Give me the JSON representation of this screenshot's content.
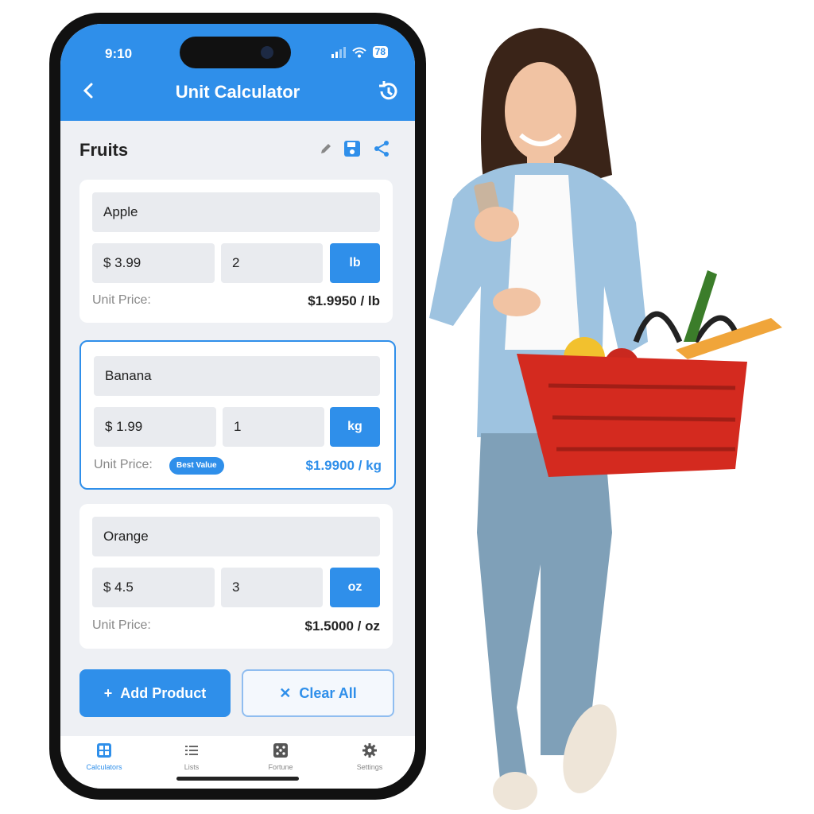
{
  "status_bar": {
    "time": "9:10",
    "battery": "78"
  },
  "header": {
    "title": "Unit Calculator"
  },
  "list": {
    "name": "Fruits"
  },
  "products": [
    {
      "name": "Apple",
      "price": "$ 3.99",
      "quantity": "2",
      "unit": "lb",
      "unit_price_label": "Unit Price:",
      "unit_price": "$1.9950 / lb"
    },
    {
      "name": "Banana",
      "price": "$ 1.99",
      "quantity": "1",
      "unit": "kg",
      "unit_price_label": "Unit Price:",
      "badge": "Best Value",
      "unit_price": "$1.9900 / kg"
    },
    {
      "name": "Orange",
      "price": "$ 4.5",
      "quantity": "3",
      "unit": "oz",
      "unit_price_label": "Unit Price:",
      "unit_price": "$1.5000 / oz"
    }
  ],
  "actions": {
    "add": "Add Product",
    "clear": "Clear All"
  },
  "tabs": [
    {
      "label": "Calculators",
      "icon": "calculator-icon",
      "active": true
    },
    {
      "label": "Lists",
      "icon": "list-icon"
    },
    {
      "label": "Fortune",
      "icon": "dice-icon"
    },
    {
      "label": "Settings",
      "icon": "gear-icon"
    }
  ],
  "colors": {
    "accent": "#2f8fea",
    "background": "#eef0f4",
    "basket": "#d42a1f"
  }
}
